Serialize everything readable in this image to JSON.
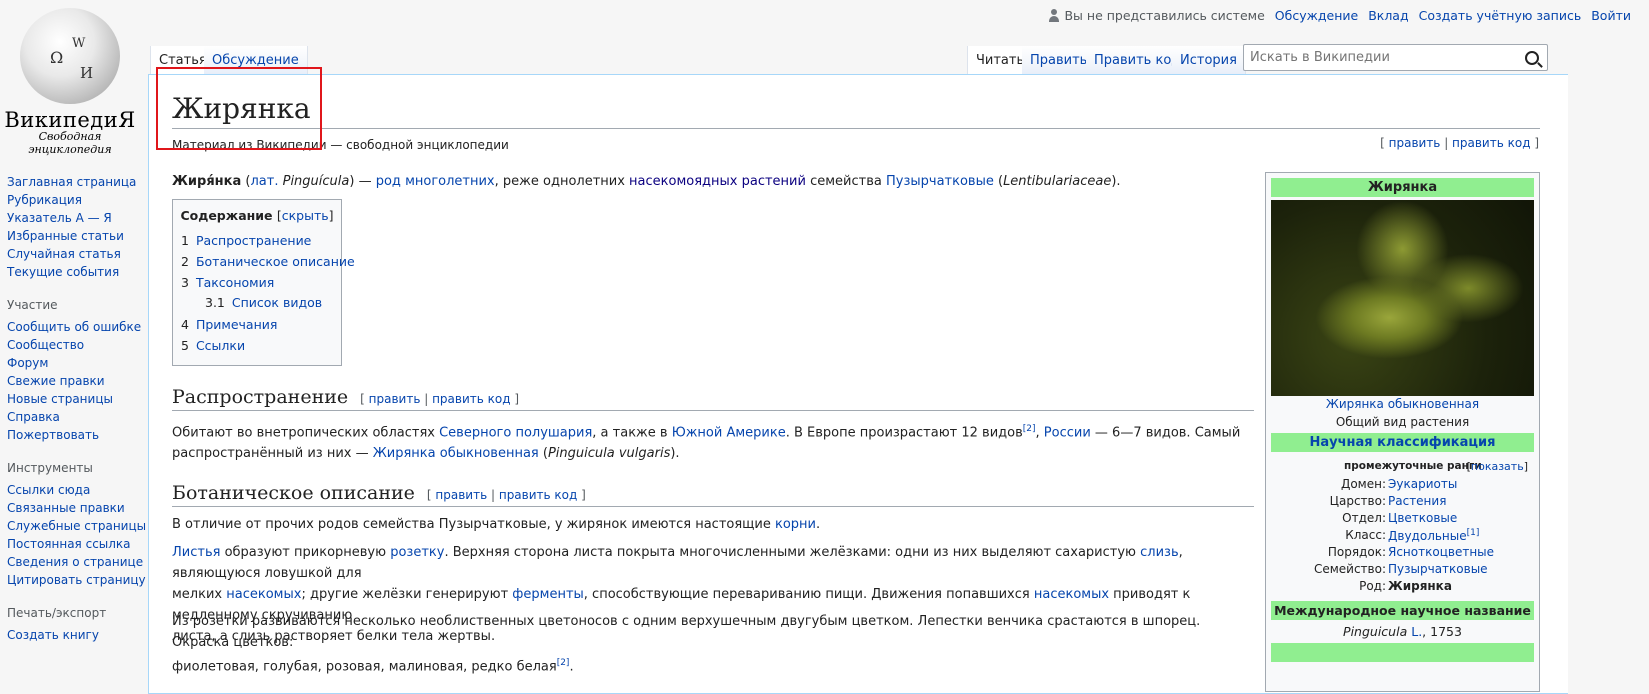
{
  "personal": {
    "anon": "Вы не представились системе",
    "talk": "Обсуждение",
    "contributions": "Вклад",
    "create_account": "Создать учётную запись",
    "login": "Войти"
  },
  "logo": {
    "wordmark": "ВикипедиЯ",
    "tagline": "Свободная энциклопедия",
    "glyphs": [
      "Ω",
      "W",
      "И"
    ]
  },
  "tabs": {
    "article": "Статья",
    "talk": "Обсуждение",
    "read": "Читать",
    "edit": "Править",
    "edit_source": "Править код",
    "history": "История"
  },
  "search": {
    "placeholder": "Искать в Википедии"
  },
  "sidebar": {
    "nav": [
      "Заглавная страница",
      "Рубрикация",
      "Указатель А — Я",
      "Избранные статьи",
      "Случайная статья",
      "Текущие события"
    ],
    "participation_heading": "Участие",
    "participation": [
      "Сообщить об ошибке",
      "Сообщество",
      "Форум",
      "Свежие правки",
      "Новые страницы",
      "Справка",
      "Пожертвовать"
    ],
    "tools_heading": "Инструменты",
    "tools": [
      "Ссылки сюда",
      "Связанные правки",
      "Служебные страницы",
      "Постоянная ссылка",
      "Сведения о странице",
      "Цитировать страницу"
    ],
    "print_heading": "Печать/экспорт",
    "print": [
      "Создать книгу"
    ]
  },
  "article": {
    "title": "Жирянка",
    "site_sub": "Материал из Википедии — свободной энциклопедии",
    "edit": "править",
    "edit_source": "править код",
    "intro": {
      "bold": "Жиря́нка",
      "p1": " (",
      "lat": "лат.",
      "p2": " ",
      "latin_name": "Pinguícula",
      "p3": ") — ",
      "genus": "род",
      "p4": " ",
      "perennial": "многолетних",
      "p5": ", реже однолетних ",
      "insectivorous": "насекомоядных растений",
      "p6": " семейства ",
      "family": "Пузырчатковые",
      "p7": " (",
      "family_latin": "Lentibulariaceae",
      "p8": ")."
    },
    "toc": {
      "title": "Содержание",
      "hide": "скрыть",
      "items": [
        {
          "num": "1",
          "text": "Распространение"
        },
        {
          "num": "2",
          "text": "Ботаническое описание"
        },
        {
          "num": "3",
          "text": "Таксономия"
        },
        {
          "num": "3.1",
          "text": "Список видов"
        },
        {
          "num": "4",
          "text": "Примечания"
        },
        {
          "num": "5",
          "text": "Ссылки"
        }
      ]
    },
    "distribution": {
      "heading": "Распространение",
      "t1": "Обитают во внетропических областях ",
      "l1": "Северного полушария",
      "t2": ", а также в ",
      "l2": "Южной Америке",
      "t3": ". В Европе произрастают 12 видов",
      "ref1": "[2]",
      "t4": ", ",
      "l3": "России",
      "t5": " — 6—7 видов. Самый",
      "t6": "распространённый из них — ",
      "l4": "Жирянка обыкновенная",
      "t7": " (",
      "t8": "Pinguicula vulgaris",
      "t9": ")."
    },
    "botany": {
      "heading": "Ботаническое описание",
      "p1a": "В отличие от прочих родов семейства Пузырчатковые, у жирянок имеются настоящие ",
      "p1link": "корни",
      "p1b": ".",
      "p2_l1": "Листья",
      "p2_t1": " образуют прикорневую ",
      "p2_l2": "розетку",
      "p2_t2": ". Верхняя сторона листа покрыта многочисленными желёзками: одни из них выделяют сахаристую ",
      "p2_l3": "слизь",
      "p2_t3": ", являющуюся ловушкой для",
      "p2_t4": "мелких ",
      "p2_l4": "насекомых",
      "p2_t5": "; другие желёзки генерируют ",
      "p2_l5": "ферменты",
      "p2_t6": ", способствующие перевариванию пищи. Движения попавшихся ",
      "p2_l6": "насекомых",
      "p2_t7": " приводят к медленному скручиванию",
      "p2_t8": "листа, а слизь растворяет белки тела жертвы.",
      "p3_t1": "Из розетки развиваются несколько необлиственных цветоносов с одним верхушечным двугубым цветком. Лепестки венчика срастаются в шпорец. Окраска цветков:",
      "p3_t2": "фиолетовая, голубая, розовая, малиновая, редко белая",
      "p3_ref": "[2]",
      "p3_t3": "."
    }
  },
  "infobox": {
    "title": "Жирянка",
    "caption_link": "Жирянка обыкновенная",
    "caption": "Общий вид растения",
    "classification": "Научная классификация",
    "intermediate": "промежуточные ранги",
    "show": "показать",
    "rows": [
      {
        "label": "Домен:",
        "value": "Эукариоты"
      },
      {
        "label": "Царство:",
        "value": "Растения"
      },
      {
        "label": "Отдел:",
        "value": "Цветковые"
      },
      {
        "label": "Класс:",
        "value": "Двудольные",
        "ref": "[1]"
      },
      {
        "label": "Порядок:",
        "value": "Ясноткоцветные"
      },
      {
        "label": "Семейство:",
        "value": "Пузырчатковые"
      },
      {
        "label": "Род:",
        "value": "Жирянка"
      }
    ],
    "intl_name": "Международное научное название",
    "sci_name": "Pinguicula",
    "author": "L.",
    "year": ", 1753"
  }
}
